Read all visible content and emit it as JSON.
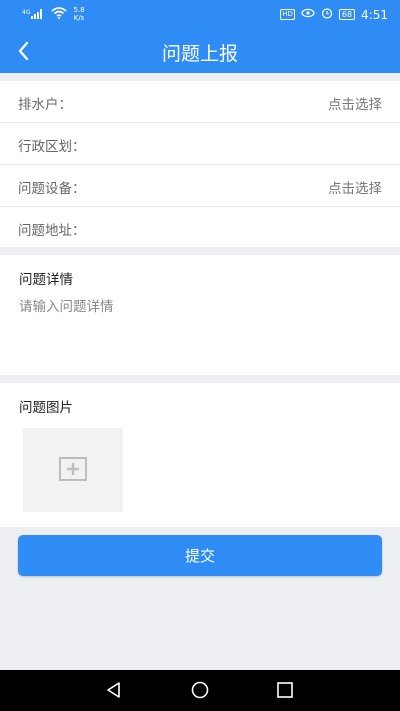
{
  "status_bar": {
    "signal_label": "4G",
    "speed_value": "5.8",
    "speed_unit": "K/s",
    "hd_label": "HD",
    "battery": "68",
    "time": "4:51"
  },
  "header": {
    "title": "问题上报"
  },
  "form": {
    "rows": [
      {
        "label": "排水户：",
        "value": "点击选择"
      },
      {
        "label": "行政区划：",
        "value": ""
      },
      {
        "label": "问题设备：",
        "value": "点击选择"
      },
      {
        "label": "问题地址：",
        "value": ""
      }
    ]
  },
  "detail": {
    "title": "问题详情",
    "placeholder": "请输入问题详情"
  },
  "photos": {
    "title": "问题图片"
  },
  "submit_label": "提交",
  "colors": {
    "primary": "#2f8cf5",
    "background": "#eceef2"
  }
}
